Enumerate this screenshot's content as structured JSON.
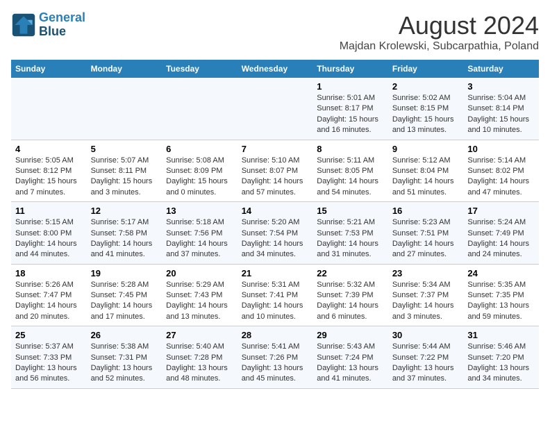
{
  "logo": {
    "line1": "General",
    "line2": "Blue"
  },
  "title": {
    "month_year": "August 2024",
    "location": "Majdan Krolewski, Subcarpathia, Poland"
  },
  "headers": [
    "Sunday",
    "Monday",
    "Tuesday",
    "Wednesday",
    "Thursday",
    "Friday",
    "Saturday"
  ],
  "weeks": [
    {
      "days": [
        {
          "num": "",
          "info": ""
        },
        {
          "num": "",
          "info": ""
        },
        {
          "num": "",
          "info": ""
        },
        {
          "num": "",
          "info": ""
        },
        {
          "num": "1",
          "info": "Sunrise: 5:01 AM\nSunset: 8:17 PM\nDaylight: 15 hours\nand 16 minutes."
        },
        {
          "num": "2",
          "info": "Sunrise: 5:02 AM\nSunset: 8:15 PM\nDaylight: 15 hours\nand 13 minutes."
        },
        {
          "num": "3",
          "info": "Sunrise: 5:04 AM\nSunset: 8:14 PM\nDaylight: 15 hours\nand 10 minutes."
        }
      ]
    },
    {
      "days": [
        {
          "num": "4",
          "info": "Sunrise: 5:05 AM\nSunset: 8:12 PM\nDaylight: 15 hours\nand 7 minutes."
        },
        {
          "num": "5",
          "info": "Sunrise: 5:07 AM\nSunset: 8:11 PM\nDaylight: 15 hours\nand 3 minutes."
        },
        {
          "num": "6",
          "info": "Sunrise: 5:08 AM\nSunset: 8:09 PM\nDaylight: 15 hours\nand 0 minutes."
        },
        {
          "num": "7",
          "info": "Sunrise: 5:10 AM\nSunset: 8:07 PM\nDaylight: 14 hours\nand 57 minutes."
        },
        {
          "num": "8",
          "info": "Sunrise: 5:11 AM\nSunset: 8:05 PM\nDaylight: 14 hours\nand 54 minutes."
        },
        {
          "num": "9",
          "info": "Sunrise: 5:12 AM\nSunset: 8:04 PM\nDaylight: 14 hours\nand 51 minutes."
        },
        {
          "num": "10",
          "info": "Sunrise: 5:14 AM\nSunset: 8:02 PM\nDaylight: 14 hours\nand 47 minutes."
        }
      ]
    },
    {
      "days": [
        {
          "num": "11",
          "info": "Sunrise: 5:15 AM\nSunset: 8:00 PM\nDaylight: 14 hours\nand 44 minutes."
        },
        {
          "num": "12",
          "info": "Sunrise: 5:17 AM\nSunset: 7:58 PM\nDaylight: 14 hours\nand 41 minutes."
        },
        {
          "num": "13",
          "info": "Sunrise: 5:18 AM\nSunset: 7:56 PM\nDaylight: 14 hours\nand 37 minutes."
        },
        {
          "num": "14",
          "info": "Sunrise: 5:20 AM\nSunset: 7:54 PM\nDaylight: 14 hours\nand 34 minutes."
        },
        {
          "num": "15",
          "info": "Sunrise: 5:21 AM\nSunset: 7:53 PM\nDaylight: 14 hours\nand 31 minutes."
        },
        {
          "num": "16",
          "info": "Sunrise: 5:23 AM\nSunset: 7:51 PM\nDaylight: 14 hours\nand 27 minutes."
        },
        {
          "num": "17",
          "info": "Sunrise: 5:24 AM\nSunset: 7:49 PM\nDaylight: 14 hours\nand 24 minutes."
        }
      ]
    },
    {
      "days": [
        {
          "num": "18",
          "info": "Sunrise: 5:26 AM\nSunset: 7:47 PM\nDaylight: 14 hours\nand 20 minutes."
        },
        {
          "num": "19",
          "info": "Sunrise: 5:28 AM\nSunset: 7:45 PM\nDaylight: 14 hours\nand 17 minutes."
        },
        {
          "num": "20",
          "info": "Sunrise: 5:29 AM\nSunset: 7:43 PM\nDaylight: 14 hours\nand 13 minutes."
        },
        {
          "num": "21",
          "info": "Sunrise: 5:31 AM\nSunset: 7:41 PM\nDaylight: 14 hours\nand 10 minutes."
        },
        {
          "num": "22",
          "info": "Sunrise: 5:32 AM\nSunset: 7:39 PM\nDaylight: 14 hours\nand 6 minutes."
        },
        {
          "num": "23",
          "info": "Sunrise: 5:34 AM\nSunset: 7:37 PM\nDaylight: 14 hours\nand 3 minutes."
        },
        {
          "num": "24",
          "info": "Sunrise: 5:35 AM\nSunset: 7:35 PM\nDaylight: 13 hours\nand 59 minutes."
        }
      ]
    },
    {
      "days": [
        {
          "num": "25",
          "info": "Sunrise: 5:37 AM\nSunset: 7:33 PM\nDaylight: 13 hours\nand 56 minutes."
        },
        {
          "num": "26",
          "info": "Sunrise: 5:38 AM\nSunset: 7:31 PM\nDaylight: 13 hours\nand 52 minutes."
        },
        {
          "num": "27",
          "info": "Sunrise: 5:40 AM\nSunset: 7:28 PM\nDaylight: 13 hours\nand 48 minutes."
        },
        {
          "num": "28",
          "info": "Sunrise: 5:41 AM\nSunset: 7:26 PM\nDaylight: 13 hours\nand 45 minutes."
        },
        {
          "num": "29",
          "info": "Sunrise: 5:43 AM\nSunset: 7:24 PM\nDaylight: 13 hours\nand 41 minutes."
        },
        {
          "num": "30",
          "info": "Sunrise: 5:44 AM\nSunset: 7:22 PM\nDaylight: 13 hours\nand 37 minutes."
        },
        {
          "num": "31",
          "info": "Sunrise: 5:46 AM\nSunset: 7:20 PM\nDaylight: 13 hours\nand 34 minutes."
        }
      ]
    }
  ]
}
